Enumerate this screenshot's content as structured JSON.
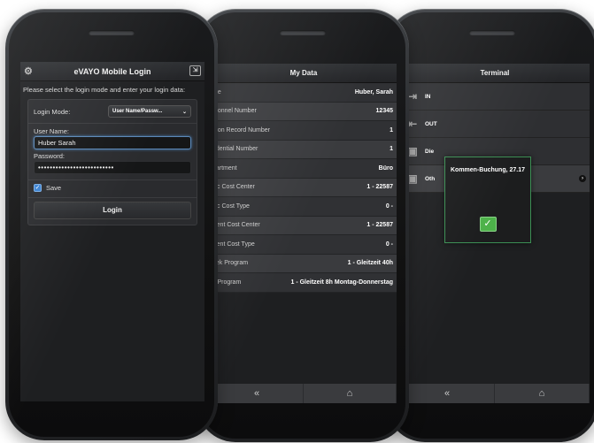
{
  "login": {
    "title": "eVAYO Mobile Login",
    "instruction": "Please select the login mode and enter your login data:",
    "mode_label": "Login Mode:",
    "mode_value": "User Name/Passw...",
    "username_label": "User Name:",
    "username_value": "Huber Sarah",
    "password_label": "Password:",
    "password_value": "••••••••••••••••••••••••••",
    "save_label": "Save",
    "login_button": "Login",
    "header_left_icon": "settings-icon",
    "header_right_icon": "exit-icon"
  },
  "mydata": {
    "title": "My Data",
    "rows": [
      {
        "label": "me",
        "value": "Huber, Sarah"
      },
      {
        "label": "rsonnel Number",
        "value": "12345"
      },
      {
        "label": "rson Record Number",
        "value": "1"
      },
      {
        "label": "edential Number",
        "value": "1"
      },
      {
        "label": "partment",
        "value": "Büro"
      },
      {
        "label": "sic Cost Center",
        "value": "1 - 22587"
      },
      {
        "label": "sic Cost Type",
        "value": "0 -"
      },
      {
        "label": "rrent Cost Center",
        "value": "1 - 22587"
      },
      {
        "label": "rrent Cost Type",
        "value": "0 -"
      },
      {
        "label": "eek Program",
        "value": "1 - Gleitzeit 40h"
      },
      {
        "label": "y Program",
        "value": "1 - Gleitzeit 8h Montag-Donnerstag"
      }
    ],
    "footer_back": "«",
    "footer_home": "home-icon"
  },
  "terminal": {
    "title": "Terminal",
    "rows": [
      {
        "label": "IN",
        "icon": "clock-in-icon"
      },
      {
        "label": "OUT",
        "icon": "clock-out-icon"
      },
      {
        "label": "Die",
        "icon": "briefcase-icon"
      },
      {
        "label": "Oth",
        "icon": "briefcase-icon"
      }
    ],
    "popup_message": "Kommen-Buchung, 27.17",
    "popup_ok_icon": "checkmark-icon",
    "footer_back": "«",
    "footer_home": "home-icon"
  },
  "colors": {
    "accent_blue": "#3b82d2",
    "success_green": "#4db24a"
  }
}
